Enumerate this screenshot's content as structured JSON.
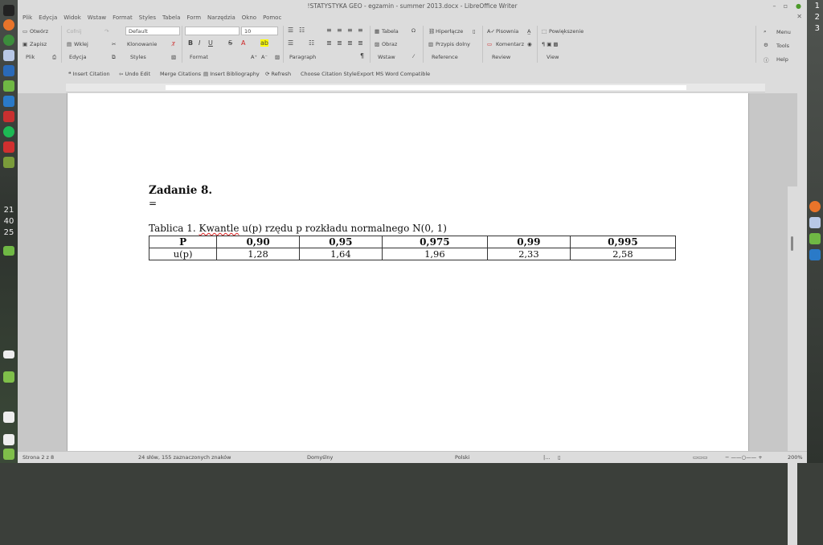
{
  "window": {
    "title": "!STATYSTYKA GEO - egzamin - summer 2013.docx - LibreOffice Writer"
  },
  "menubar": [
    "Plik",
    "Edycja",
    "Widok",
    "Wstaw",
    "Format",
    "Styles",
    "Tabela",
    "Form",
    "Narzędzia",
    "Okno",
    "Pomoc"
  ],
  "toolbar": {
    "open": "Otwórz",
    "undo": "Cofnij",
    "save": "Zapisz",
    "paste": "Wklej",
    "clone": "Klonowanie",
    "file_group": "Plik",
    "edit_group": "Edycja",
    "styles_group": "Styles",
    "format_group": "Format",
    "paragraph_group": "Paragraph",
    "insert_group": "Wstaw",
    "reference_group": "Reference",
    "review_group": "Review",
    "view_group": "View",
    "style_value": "Default",
    "font_value": "",
    "size_value": "10",
    "table": "Tabela",
    "image": "Obraz",
    "hyperlink": "Hiperłącze",
    "footnote": "Przypis dolny",
    "spelling": "Pisownia",
    "comment": "Komentarz",
    "zoom": "Powiększenie",
    "menu": "Menu",
    "tools": "Tools",
    "help": "Help"
  },
  "citebar": {
    "insert_citation": "Insert Citation",
    "undo_edit": "Undo Edit",
    "merge_citations": "Merge Citations",
    "insert_bibliography": "Insert Bibliography",
    "refresh": "Refresh",
    "choose_style": "Choose Citation Style",
    "export": "Export MS Word Compatible"
  },
  "document": {
    "heading": "Zadanie 8.",
    "equals": "=",
    "caption_pre": "Tablica 1. ",
    "caption_word": "Kwantle",
    "caption_post": " u(p) rzędu p rozkładu normalnego N(0, 1)",
    "table": {
      "header": [
        "P",
        "0,90",
        "0,95",
        "0,975",
        "0,99",
        "0,995"
      ],
      "row": [
        "u(p)",
        "1,28",
        "1,64",
        "1,96",
        "2,33",
        "2,58"
      ]
    }
  },
  "statusbar": {
    "page": "Strona 2 z 8",
    "words": "24 słów, 155 zaznaczonych znaków",
    "style": "Domyślny",
    "language": "Polski",
    "zoom": "200%"
  },
  "dock": {
    "clock": [
      "21",
      "40",
      "25"
    ],
    "workspaces": [
      "1",
      "2",
      "3"
    ]
  }
}
